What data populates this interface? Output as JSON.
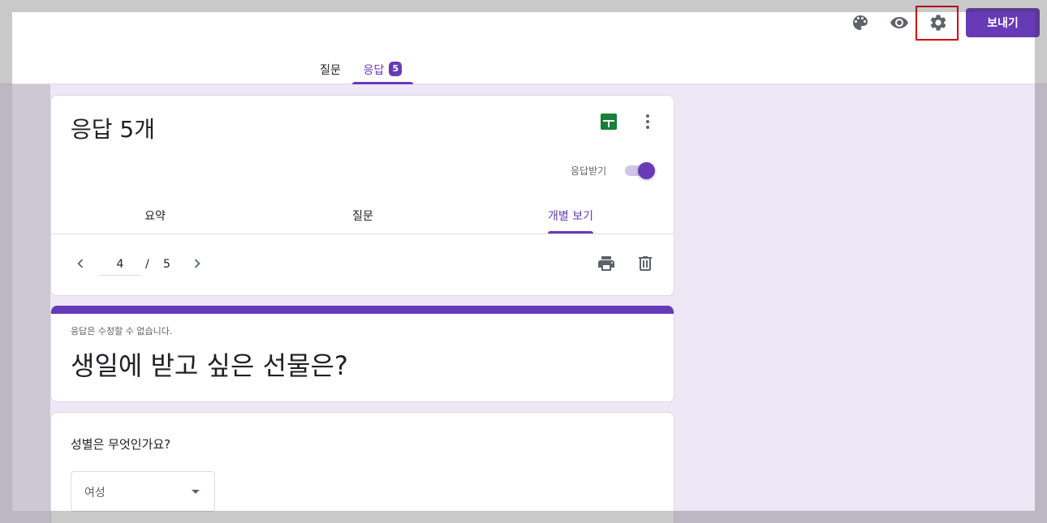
{
  "header": {
    "send_label": "보내기",
    "icons": [
      "palette-icon",
      "eye-icon",
      "gear-icon"
    ],
    "tabs": [
      {
        "label": "질문",
        "active": false
      },
      {
        "label": "응답",
        "active": true,
        "badge": "5"
      }
    ]
  },
  "responses_card": {
    "title": "응답 5개",
    "accept_label": "응답받기",
    "accepting": true,
    "sub_tabs": [
      {
        "label": "요약",
        "active": false
      },
      {
        "label": "질문",
        "active": false
      },
      {
        "label": "개별 보기",
        "active": true
      }
    ],
    "pager": {
      "current": "4",
      "separator": "/",
      "total": "5"
    }
  },
  "form_card": {
    "note": "응답은 수정할 수 없습니다.",
    "title": "생일에 받고 싶은 선물은?"
  },
  "question_card": {
    "label": "성별은 무엇인가요?",
    "answer": "여성"
  },
  "colors": {
    "accent": "#673ab7",
    "background": "#ede7f6",
    "sheets_green": "#188038",
    "highlight_red": "#d50000"
  }
}
